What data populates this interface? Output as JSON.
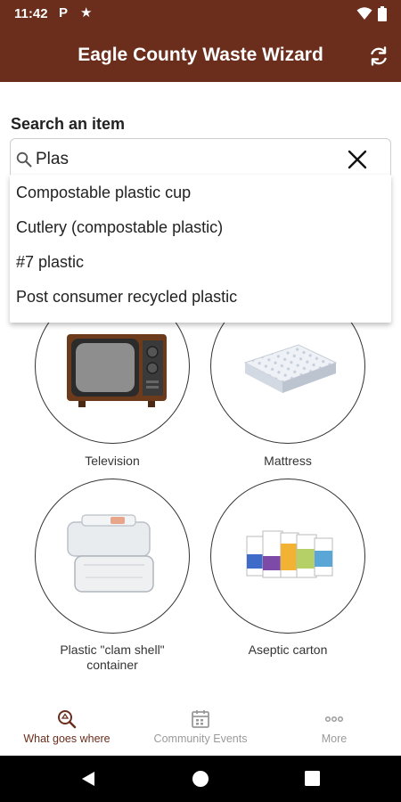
{
  "status_bar": {
    "time": "11:42",
    "p_icon": "P",
    "star_icon": "★"
  },
  "header": {
    "title": "Eagle County Waste Wizard",
    "refresh_icon": "refresh-icon",
    "color": "#6b2e1d"
  },
  "search": {
    "label": "Search an item",
    "value": "Plas",
    "placeholder": "",
    "suggestions": [
      "Compostable plastic cup",
      "Cutlery (compostable plastic)",
      "#7 plastic",
      "Post consumer recycled plastic"
    ]
  },
  "items": [
    {
      "label": "Television"
    },
    {
      "label": "Mattress"
    },
    {
      "label": "Plastic \"clam shell\" container"
    },
    {
      "label": "Aseptic carton"
    }
  ],
  "bottom_nav": [
    {
      "label": "What goes where",
      "icon": "search-recycle-icon",
      "active": true
    },
    {
      "label": "Community Events",
      "icon": "calendar-icon",
      "active": false
    },
    {
      "label": "More",
      "icon": "more-dots-icon",
      "active": false
    }
  ]
}
